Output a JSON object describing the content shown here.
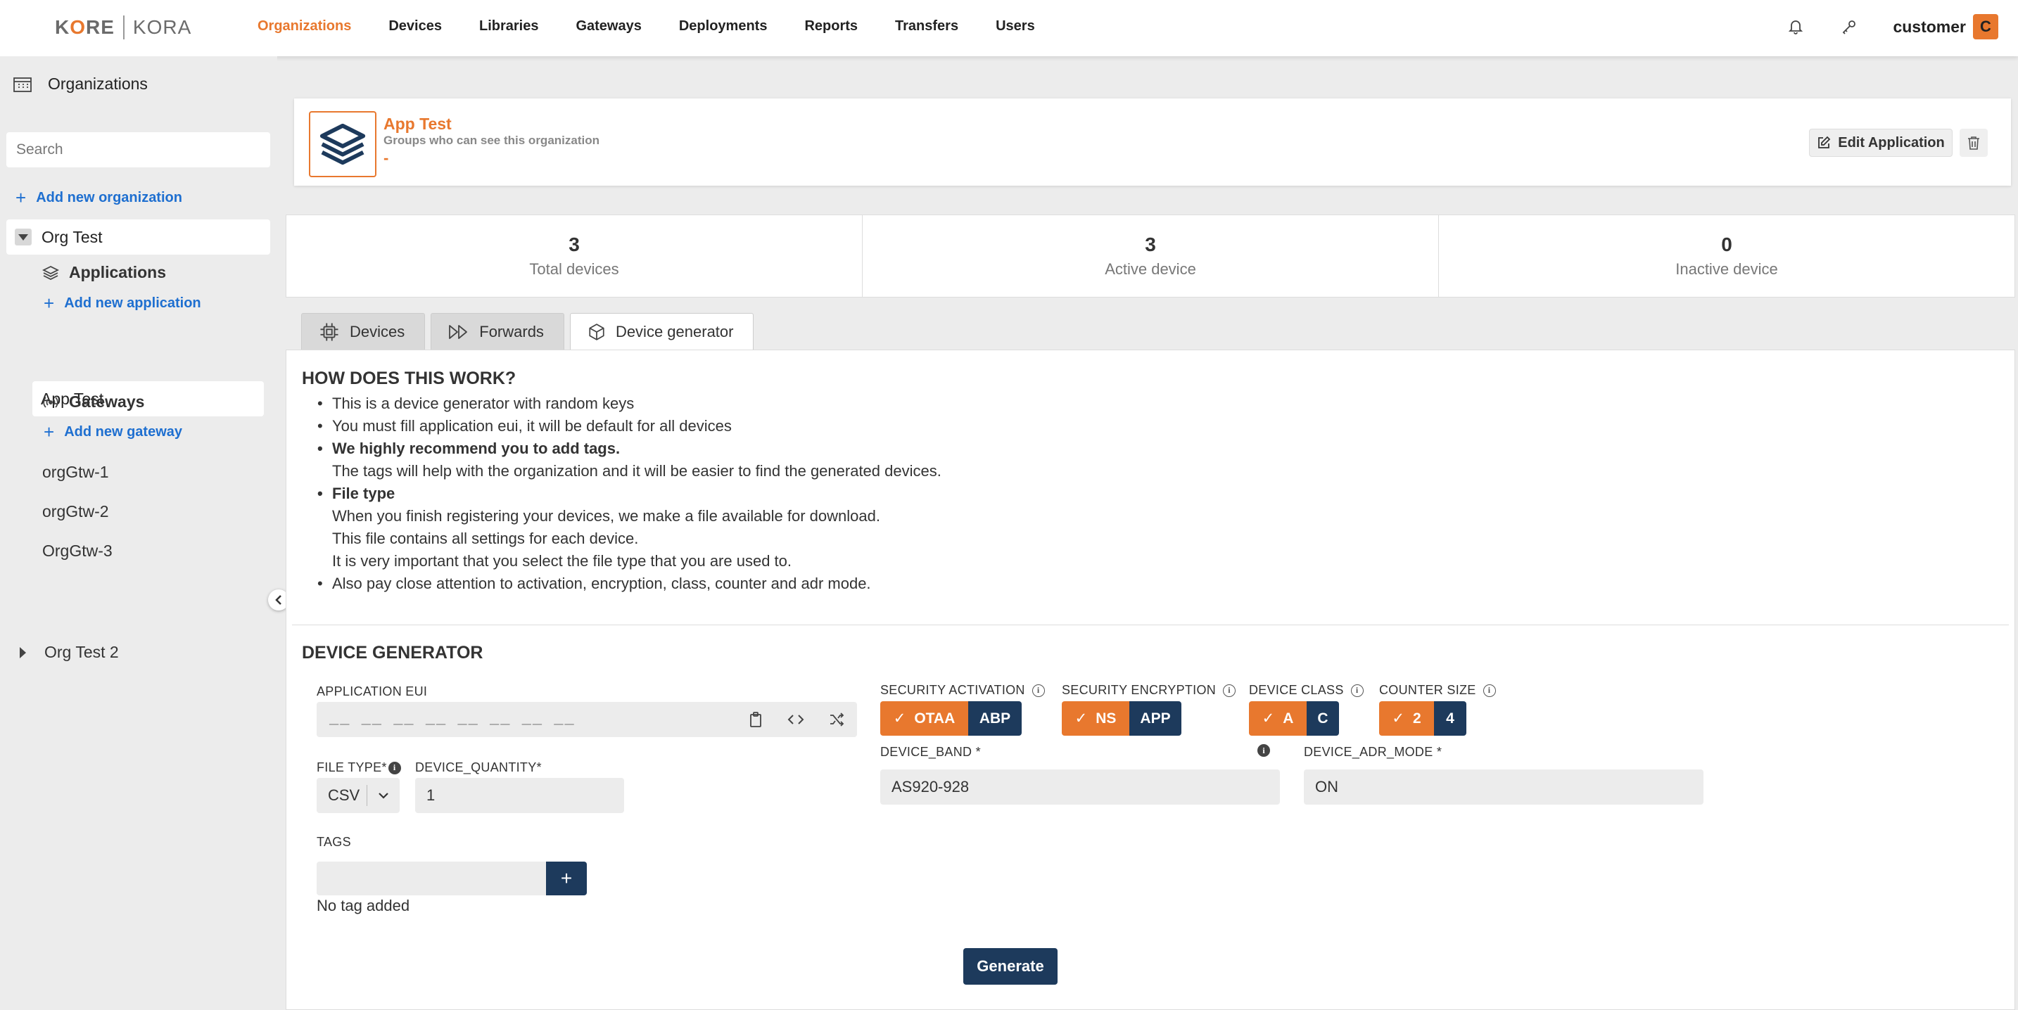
{
  "brand": {
    "kore_prefix": "K",
    "kore_o": "O",
    "kore_suffix": "RE",
    "kora": "KORA"
  },
  "nav": {
    "items": [
      "Organizations",
      "Devices",
      "Libraries",
      "Gateways",
      "Deployments",
      "Reports",
      "Transfers",
      "Users"
    ],
    "active": "Organizations",
    "user": "customer",
    "avatar_letter": "C"
  },
  "sidebar": {
    "title": "Organizations",
    "search_placeholder": "Search",
    "add_org": "Add new organization",
    "org": "Org Test",
    "applications_label": "Applications",
    "add_app": "Add new application",
    "app": "App Test",
    "gateways_label": "Gateways",
    "add_gateway": "Add new gateway",
    "gateways": [
      "orgGtw-1",
      "orgGtw-2",
      "OrgGtw-3"
    ],
    "org2": "Org Test 2"
  },
  "app": {
    "title": "App Test",
    "subtitle": "Groups who can see this organization",
    "groups": "-",
    "edit_label": "Edit Application"
  },
  "stats": [
    {
      "num": "3",
      "label": "Total devices"
    },
    {
      "num": "3",
      "label": "Active device"
    },
    {
      "num": "0",
      "label": "Inactive device"
    }
  ],
  "tabs": [
    "Devices",
    "Forwards",
    "Device generator"
  ],
  "how": {
    "title": "HOW DOES THIS WORK?",
    "line1": "This is a device generator with random keys",
    "line2": "You must fill application eui, it will be default for all devices",
    "line3": "We highly recommend you to add tags.",
    "line3b": "The tags will help with the organization and it will be easier to find the generated devices.",
    "line4": "File type",
    "line4b": "When you finish registering your devices, we make a file available for download.",
    "line4c": "This file contains all settings for each device.",
    "line4d": "It is very important that you select the file type that you are used to.",
    "line5": "Also pay close attention to activation, encryption, class, counter and adr mode."
  },
  "generator": {
    "title": "DEVICE GENERATOR",
    "eui_label": "APPLICATION EUI",
    "eui_mask": "__ __ __ __ __ __ __ __",
    "file_type_label": "FILE TYPE*",
    "file_type": "CSV",
    "qty_label": "DEVICE_QUANTITY*",
    "qty": "1",
    "tags_label": "TAGS",
    "no_tag": "No tag added",
    "sec_act_label": "SECURITY ACTIVATION",
    "sec_act": [
      "OTAA",
      "ABP"
    ],
    "sec_enc_label": "SECURITY ENCRYPTION",
    "sec_enc": [
      "NS",
      "APP"
    ],
    "class_label": "DEVICE CLASS",
    "class": [
      "A",
      "C"
    ],
    "counter_label": "COUNTER SIZE",
    "counter": [
      "2",
      "4"
    ],
    "band_label": "DEVICE_BAND *",
    "band": "AS920-928",
    "adr_label": "DEVICE_ADR_MODE *",
    "adr": "ON",
    "generate": "Generate"
  },
  "colors": {
    "accent": "#e8782e",
    "navy": "#1d3a5c",
    "link": "#1e6fd0"
  }
}
